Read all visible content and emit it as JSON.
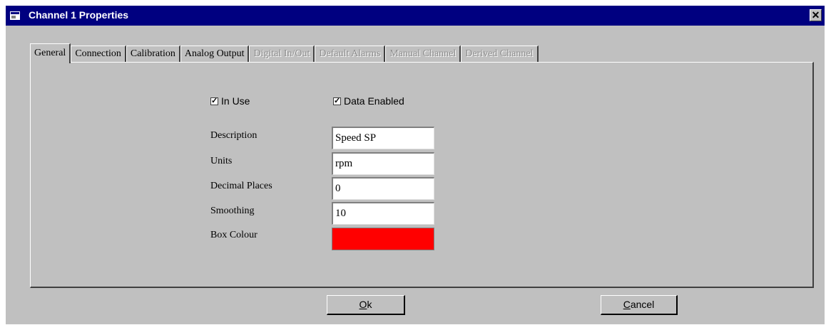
{
  "window": {
    "title": "Channel 1 Properties",
    "close_glyph": "✕",
    "icon": "app-window-icon"
  },
  "tabs": [
    {
      "label": "General",
      "state": "active"
    },
    {
      "label": "Connection",
      "state": "enabled"
    },
    {
      "label": "Calibration",
      "state": "enabled"
    },
    {
      "label": "Analog Output",
      "state": "enabled"
    },
    {
      "label": "Digital In/Out",
      "state": "disabled"
    },
    {
      "label": "Default Alarms",
      "state": "disabled"
    },
    {
      "label": "Manual Channel",
      "state": "disabled"
    },
    {
      "label": "Derived Channel",
      "state": "disabled"
    }
  ],
  "general": {
    "in_use": {
      "label": "In Use",
      "checked": true
    },
    "data_enabled": {
      "label": "Data Enabled",
      "checked": true
    },
    "fields": {
      "description": {
        "label": "Description",
        "value": "Speed SP"
      },
      "units": {
        "label": "Units",
        "value": "rpm"
      },
      "decimal_places": {
        "label": "Decimal Places",
        "value": "0"
      },
      "smoothing": {
        "label": "Smoothing",
        "value": "10"
      },
      "box_colour": {
        "label": "Box Colour",
        "color": "#ff0000"
      }
    }
  },
  "buttons": {
    "ok": {
      "accel": "O",
      "rest": "k"
    },
    "cancel": {
      "accel": "C",
      "rest": "ancel"
    }
  },
  "colors": {
    "title_bar": "#000080",
    "face": "#c0c0c0",
    "disabled_text": "#8f8f8f"
  }
}
